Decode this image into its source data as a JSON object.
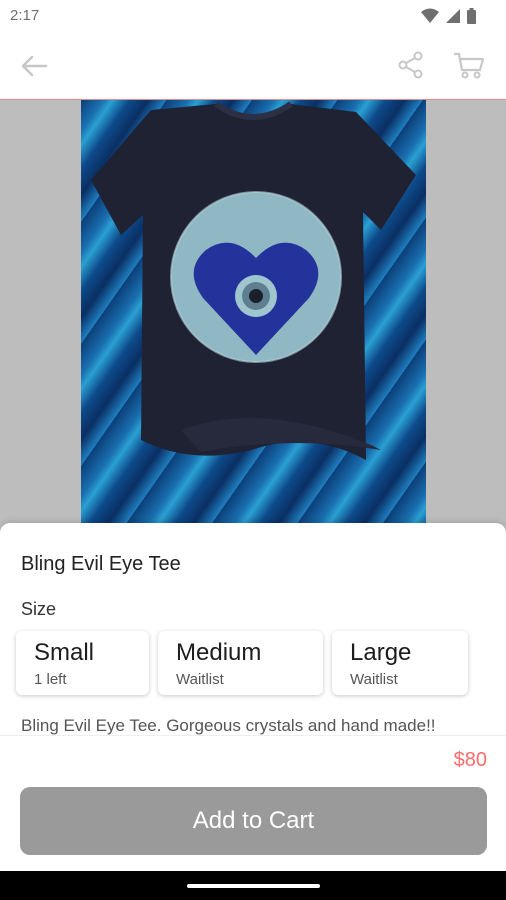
{
  "status": {
    "time": "2:17"
  },
  "toolbar": {
    "back_icon": "arrow-left-icon",
    "share_icon": "share-icon",
    "cart_icon": "cart-icon"
  },
  "product": {
    "title": "Bling Evil Eye Tee",
    "size_label": "Size",
    "sizes": [
      {
        "name": "Small",
        "availability": "1 left"
      },
      {
        "name": "Medium",
        "availability": "Waitlist"
      },
      {
        "name": "Large",
        "availability": "Waitlist"
      }
    ],
    "description": "Bling Evil Eye Tee. Gorgeous crystals and hand made!!",
    "price": "$80",
    "add_to_cart_label": "Add to Cart"
  },
  "colors": {
    "accent": "#ff6b6b",
    "button": "#9a9a9a",
    "toolbar_border": "#e98a8a"
  }
}
